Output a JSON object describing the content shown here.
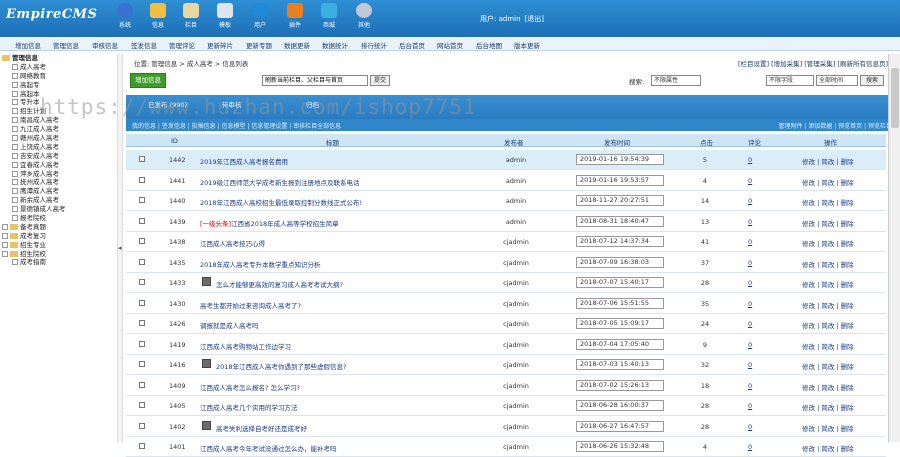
{
  "app": {
    "logo": "EmpireCMS",
    "user_label": "用户: admin",
    "logout": "[退出]"
  },
  "toolbar": [
    "系统",
    "信息",
    "栏目",
    "模板",
    "用户",
    "插件",
    "商城",
    "其他"
  ],
  "menu": [
    "增加信息",
    "管理信息",
    "审核信息",
    "签发信息",
    "管理评论",
    "更新碎片",
    "更新专题",
    "数据更新",
    "数据统计",
    "排行统计",
    "后台首页",
    "网站首页",
    "后台地图",
    "版本更新"
  ],
  "tree": {
    "root": "管理信息",
    "children": [
      "成人高考",
      "网络教育",
      "高起专",
      "高起本",
      "专升本",
      "招生计划",
      "南昌成人高考",
      "九江成人高考",
      "赣州成人高考",
      "上饶成人高考",
      "吉安成人高考",
      "宜春成人高考",
      "萍乡成人高考",
      "抚州成人高考",
      "鹰潭成人高考",
      "新余成人高考",
      "景德镇成人高考",
      "报考院校"
    ],
    "folders": [
      "备考真题",
      "成考复习",
      "招生专业",
      "招生院校"
    ],
    "last": "成考指南"
  },
  "location": "位置: 管理信息 > 成人高考 > 信息列表",
  "right_links": "[栏目设置] [增加采集] [管理采集] [刷新所有信息页]",
  "add_button": "增加信息",
  "refresh_select": "刷新当前栏目、父栏目与首页",
  "submit": "提交",
  "search": {
    "label": "搜索:",
    "attr": "不限属性",
    "field": "不限字段",
    "time": "全部时间",
    "button": "搜索"
  },
  "tabs": [
    "已发布 (990)",
    "待审核",
    "归档"
  ],
  "subbar_left": "我的信息 | 签发信息 | 投稿信息 | 信息模型 | 信息管理设置 | 审核栏目全部信息",
  "subbar_right": "管理附件 | 添加数据 | 预览首页 | 预览栏目",
  "columns": {
    "id": "ID",
    "title": "标题",
    "author": "发布者",
    "time": "发布时间",
    "clicks": "点击",
    "comments": "评论",
    "ops": "操作"
  },
  "rows": [
    {
      "id": "1442",
      "title": "2019年江西成人高考报名费用",
      "author": "admin",
      "time": "2019-01-16 19:54:39",
      "clicks": "5",
      "comments": "0",
      "icon": false,
      "tag": ""
    },
    {
      "id": "1441",
      "title": "2019级江西师范大学成考新生报到注册地点及联系电话",
      "author": "admin",
      "time": "2019-01-16 19:53:57",
      "clicks": "4",
      "comments": "0",
      "icon": false,
      "tag": ""
    },
    {
      "id": "1440",
      "title": "2018年江西成人高校招生最低录取控制分数线正式公布!",
      "author": "admin",
      "time": "2018-11-27 20:27:51",
      "clicks": "14",
      "comments": "0",
      "icon": false,
      "tag": ""
    },
    {
      "id": "1439",
      "title": "江西省2018年成人高等学校招生简章",
      "author": "admin",
      "time": "2018-08-31 18:40:47",
      "clicks": "13",
      "comments": "0",
      "icon": false,
      "tag": "[一级头条]"
    },
    {
      "id": "1438",
      "title": "江西成人高考技巧心得",
      "author": "cjadmin",
      "time": "2018-07-12 14:37:34",
      "clicks": "41",
      "comments": "0",
      "icon": false,
      "tag": ""
    },
    {
      "id": "1435",
      "title": "2018年成人高考专升本数学重点知识分析",
      "author": "cjadmin",
      "time": "2018-07-09 16:38:03",
      "clicks": "37",
      "comments": "0",
      "icon": false,
      "tag": ""
    },
    {
      "id": "1433",
      "title": "怎么才能够更高效的复习成人高考考试大纲?",
      "author": "cjadmin",
      "time": "2018-07-07 15:40:17",
      "clicks": "28",
      "comments": "0",
      "icon": true,
      "tag": ""
    },
    {
      "id": "1430",
      "title": "高考生都开始过来咨询成人高考了?",
      "author": "cjadmin",
      "time": "2018-07-06 15:51:55",
      "clicks": "35",
      "comments": "0",
      "icon": false,
      "tag": ""
    },
    {
      "id": "1426",
      "title": "调报就是成人高考吗",
      "author": "cjadmin",
      "time": "2018-07-05 15:09:17",
      "clicks": "24",
      "comments": "0",
      "icon": false,
      "tag": ""
    },
    {
      "id": "1419",
      "title": "江西成人高考购物站工作边学习",
      "author": "cjadmin",
      "time": "2018-07-04 17:05:40",
      "clicks": "9",
      "comments": "0",
      "icon": false,
      "tag": ""
    },
    {
      "id": "1416",
      "title": "2018年江西成人高考你遇到了那些虚假信息?",
      "author": "cjadmin",
      "time": "2018-07-03 15:40:13",
      "clicks": "32",
      "comments": "0",
      "icon": true,
      "tag": ""
    },
    {
      "id": "1409",
      "title": "江西成人高考怎么报名? 怎么学习?",
      "author": "cjadmin",
      "time": "2018-07-02 15:26:13",
      "clicks": "18",
      "comments": "0",
      "icon": false,
      "tag": ""
    },
    {
      "id": "1405",
      "title": "江西成人高考几个实用的学习方法",
      "author": "cjadmin",
      "time": "2018-06-28 16:00:37",
      "clicks": "28",
      "comments": "0",
      "icon": false,
      "tag": ""
    },
    {
      "id": "1402",
      "title": "高考失利选择自考好还是成考好",
      "author": "cjadmin",
      "time": "2018-06-27 16:47:57",
      "clicks": "28",
      "comments": "0",
      "icon": true,
      "tag": ""
    },
    {
      "id": "1401",
      "title": "江西成人高考今年考试没通过怎么办，能补考吗",
      "author": "cjadmin",
      "time": "2018-06-26 15:32:48",
      "clicks": "4",
      "comments": "0",
      "icon": false,
      "tag": ""
    }
  ],
  "ops_text": "修改 | 简改 | 删除",
  "watermark": "https://www.huzhan.com/ishop7751",
  "colors": {
    "header": "#2a80c8",
    "accent_green": "#3e9c29",
    "row_highlight": "#dcedfa"
  }
}
